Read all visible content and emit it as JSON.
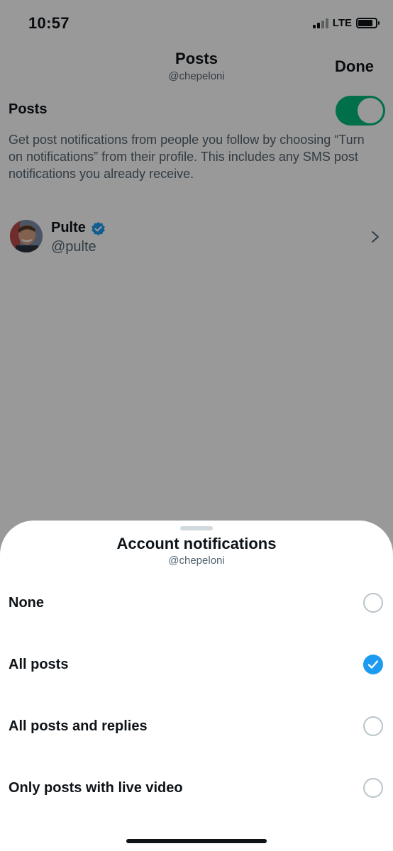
{
  "status_bar": {
    "time": "10:57",
    "network": "LTE",
    "signal_bars": 2,
    "signal_total": 4,
    "battery_level": 0.85
  },
  "header": {
    "title": "Posts",
    "subtitle": "@chepeloni",
    "done_label": "Done"
  },
  "posts_setting": {
    "label": "Posts",
    "enabled": true,
    "description": "Get post notifications from people you follow by choosing “Turn on notifications” from their profile. This includes any SMS post notifications you already receive."
  },
  "account": {
    "name": "Pulte",
    "handle": "@pulte",
    "verified": true
  },
  "sheet": {
    "title": "Account notifications",
    "subtitle": "@chepeloni",
    "options": [
      {
        "label": "None",
        "selected": false
      },
      {
        "label": "All posts",
        "selected": true
      },
      {
        "label": "All posts and replies",
        "selected": false
      },
      {
        "label": "Only posts with live video",
        "selected": false
      }
    ]
  },
  "colors": {
    "toggle_on": "#00ba7c",
    "accent": "#1d9bf0",
    "text": "#0f1419",
    "secondary": "#536471"
  }
}
